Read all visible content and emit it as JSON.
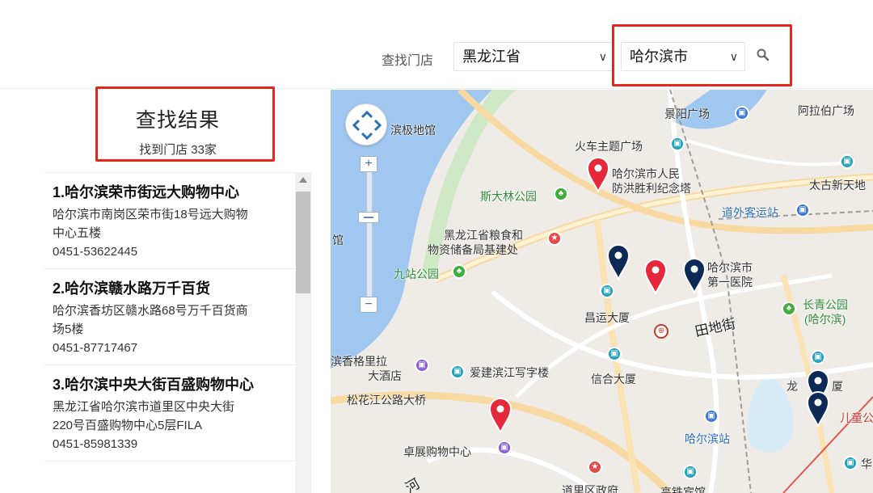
{
  "search": {
    "label": "查找门店",
    "province": "黑龙江省",
    "city": "哈尔滨市"
  },
  "results": {
    "title": "查找结果",
    "count_text": "找到门店 33家"
  },
  "stores": [
    {
      "name": "1.哈尔滨荣市街远大购物中心",
      "addr1": "哈尔滨市南岗区荣市街18号远大购物",
      "addr2": "中心五楼",
      "phone": "0451-53622445"
    },
    {
      "name": "2.哈尔滨赣水路万千百货",
      "addr1": "哈尔滨香坊区赣水路68号万千百货商",
      "addr2": "场5楼",
      "phone": "0451-87717467"
    },
    {
      "name": "3.哈尔滨中央大街百盛购物中心",
      "addr1": "黑龙江省哈尔滨市道里区中央大街",
      "addr2": "220号百盛购物中心5层FILA",
      "phone": "0451-85981339"
    }
  ],
  "map": {
    "labels": {
      "jingyang": "景阳广场",
      "alabo": "阿拉伯广场",
      "jidi": "滨极地馆",
      "huoche": "火车主题广场",
      "monument1": "哈尔滨市人民",
      "monument2": "防洪胜利纪念塔",
      "stalin": "斯大林公园",
      "taigu": "太古新天地",
      "daowai": "道外客运站",
      "grain1": "黑龙江省粮食和",
      "grain2": "物资储备局基建处",
      "guan": "馆",
      "jiuzhan": "九站公园",
      "hosp1": "哈尔滨市",
      "hosp2": "第一医院",
      "changyun": "昌运大厦",
      "tiandi": "田地街",
      "changqing1": "长青公园",
      "changqing2": "(哈尔滨)",
      "shangri1": "滨香格里拉",
      "shangri2": "大酒店",
      "aijian": "爱建滨江写字楼",
      "xinhe": "信合大厦",
      "bridge": "松花江公路大桥",
      "longjiang": "龙",
      "longjiang2": "厦",
      "ertong": "儿童公",
      "station": "哈尔滨站",
      "zhuozhan": "卓展购物中心",
      "hua": "华",
      "daoli": "道里区政府",
      "gaotie": "高铁宾馆",
      "he": "河"
    }
  },
  "colors": {
    "highlight": "#e3261e",
    "water": "#9fc7f0",
    "pin_red": "#e5283a",
    "pin_navy": "#0c2a55"
  }
}
